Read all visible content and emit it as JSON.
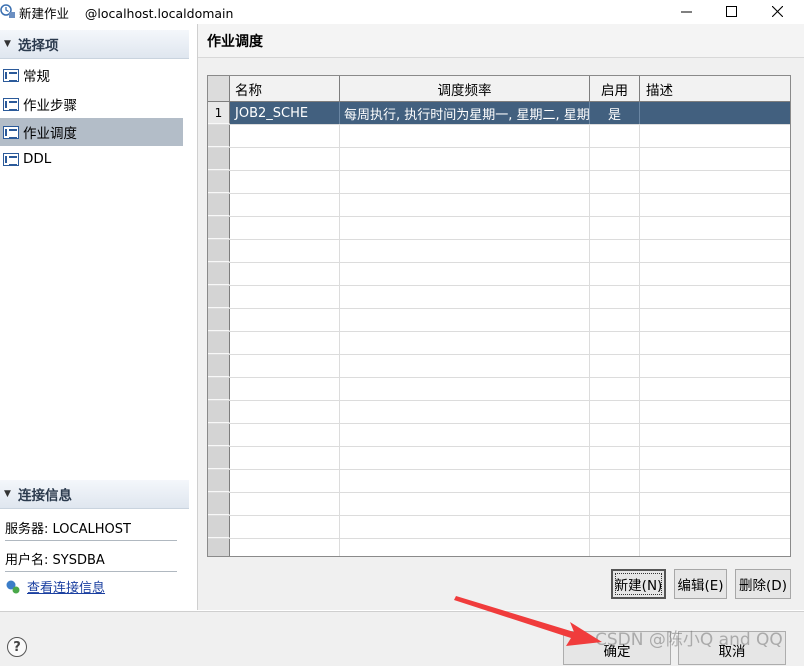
{
  "window": {
    "title": "新建作业",
    "host": "@localhost.localdomain"
  },
  "sidebar": {
    "options_header": "选择项",
    "items": [
      {
        "label": "常规"
      },
      {
        "label": "作业步骤"
      },
      {
        "label": "作业调度"
      },
      {
        "label": "DDL"
      }
    ],
    "connection_header": "连接信息",
    "server_line": "服务器: LOCALHOST",
    "user_line": "用户名: SYSDBA",
    "view_connection_link": "查看连接信息"
  },
  "main": {
    "title": "作业调度",
    "table": {
      "columns": [
        "名称",
        "调度频率",
        "启用",
        "描述"
      ],
      "rows": [
        {
          "index": "1",
          "name": "JOB2_SCHE",
          "frequency": "每周执行, 执行时间为星期一, 星期二, 星期三",
          "enabled": "是",
          "description": ""
        }
      ]
    },
    "buttons": {
      "new": "新建(N)",
      "edit": "编辑(E)",
      "delete": "删除(D)"
    }
  },
  "footer": {
    "ok": "确定",
    "cancel": "取消",
    "watermark": "CSDN @陈小Q and QQ"
  },
  "colors": {
    "selected_row": "#42607f",
    "selected_nav": "#b3bdc8",
    "annotation_arrow": "#f03c3c"
  }
}
